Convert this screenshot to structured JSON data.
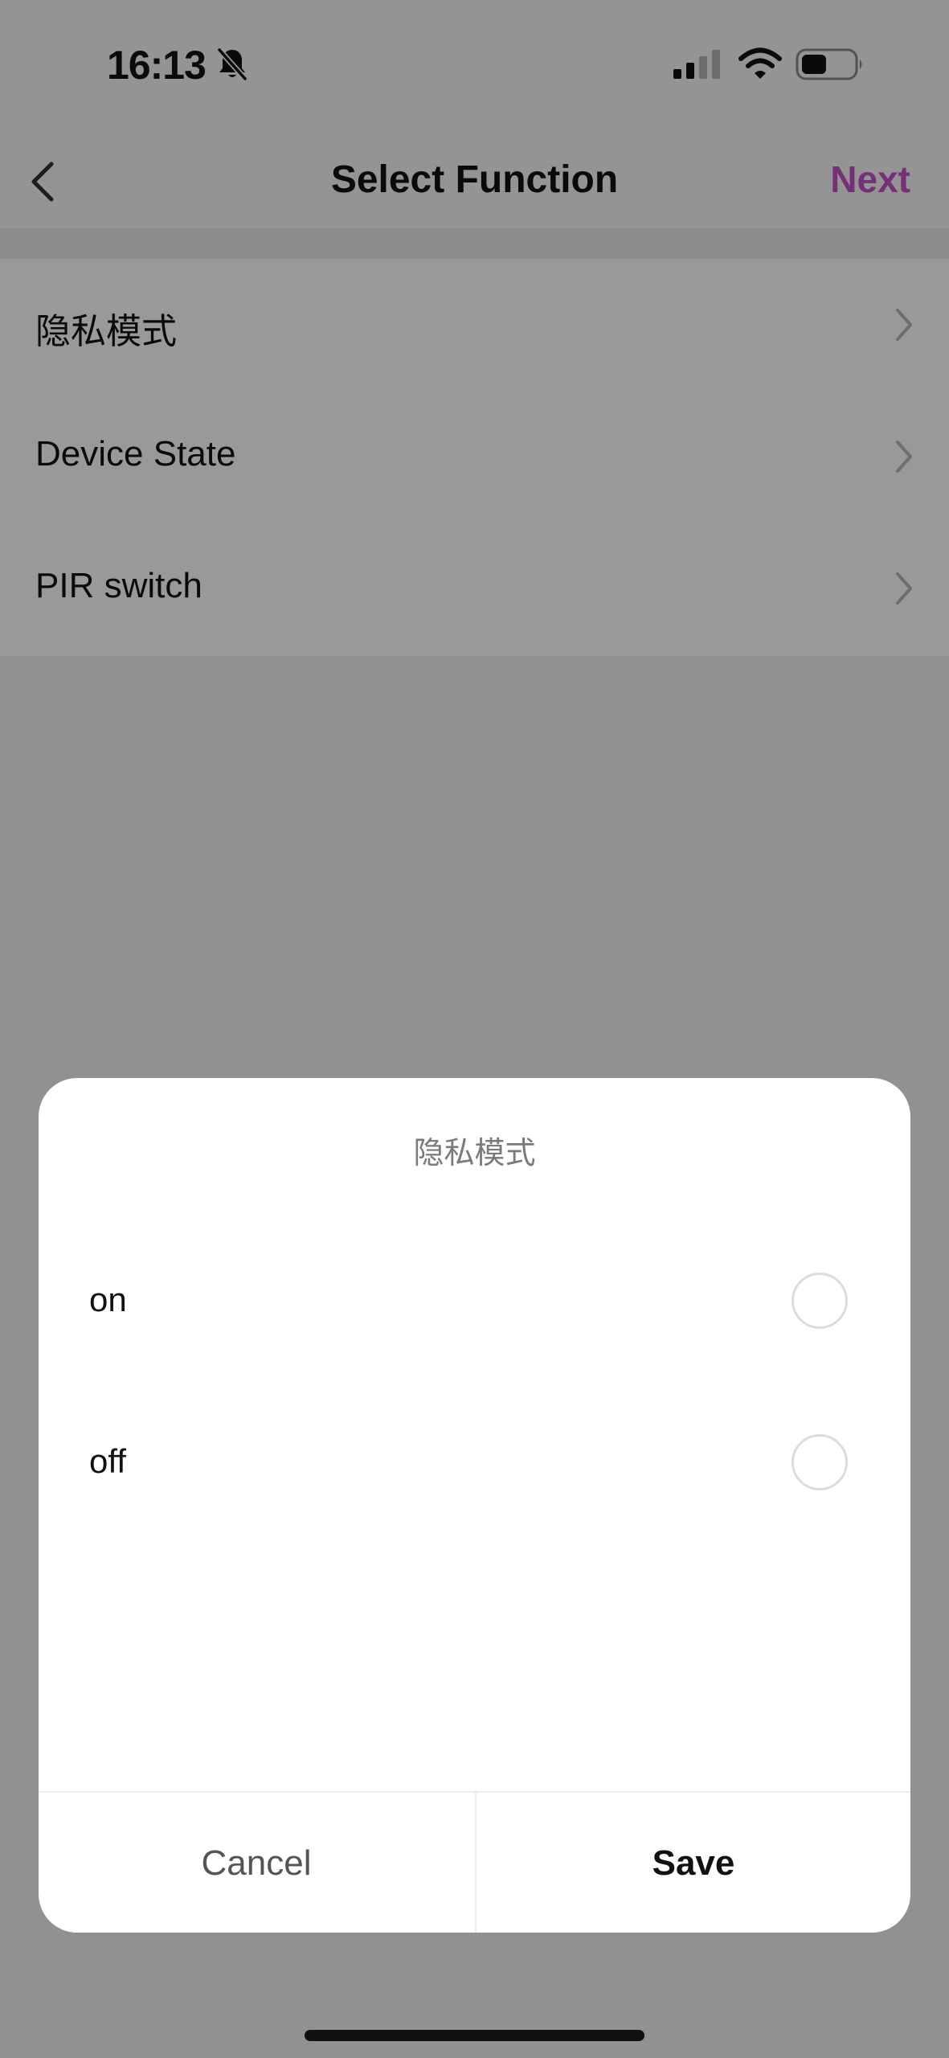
{
  "status_bar": {
    "time": "16:13",
    "icons": [
      "bell-slash-icon",
      "signal-icon",
      "wifi-icon",
      "battery-icon"
    ]
  },
  "nav": {
    "back_icon": "chevron-left-icon",
    "title": "Select Function",
    "next_label": "Next",
    "next_color": "#c651c7"
  },
  "functions": [
    {
      "label": "隐私模式"
    },
    {
      "label": "Device State"
    },
    {
      "label": "PIR switch"
    }
  ],
  "dialog": {
    "title": "隐私模式",
    "options": [
      {
        "label": "on",
        "selected": false
      },
      {
        "label": "off",
        "selected": false
      }
    ],
    "cancel_label": "Cancel",
    "save_label": "Save"
  }
}
